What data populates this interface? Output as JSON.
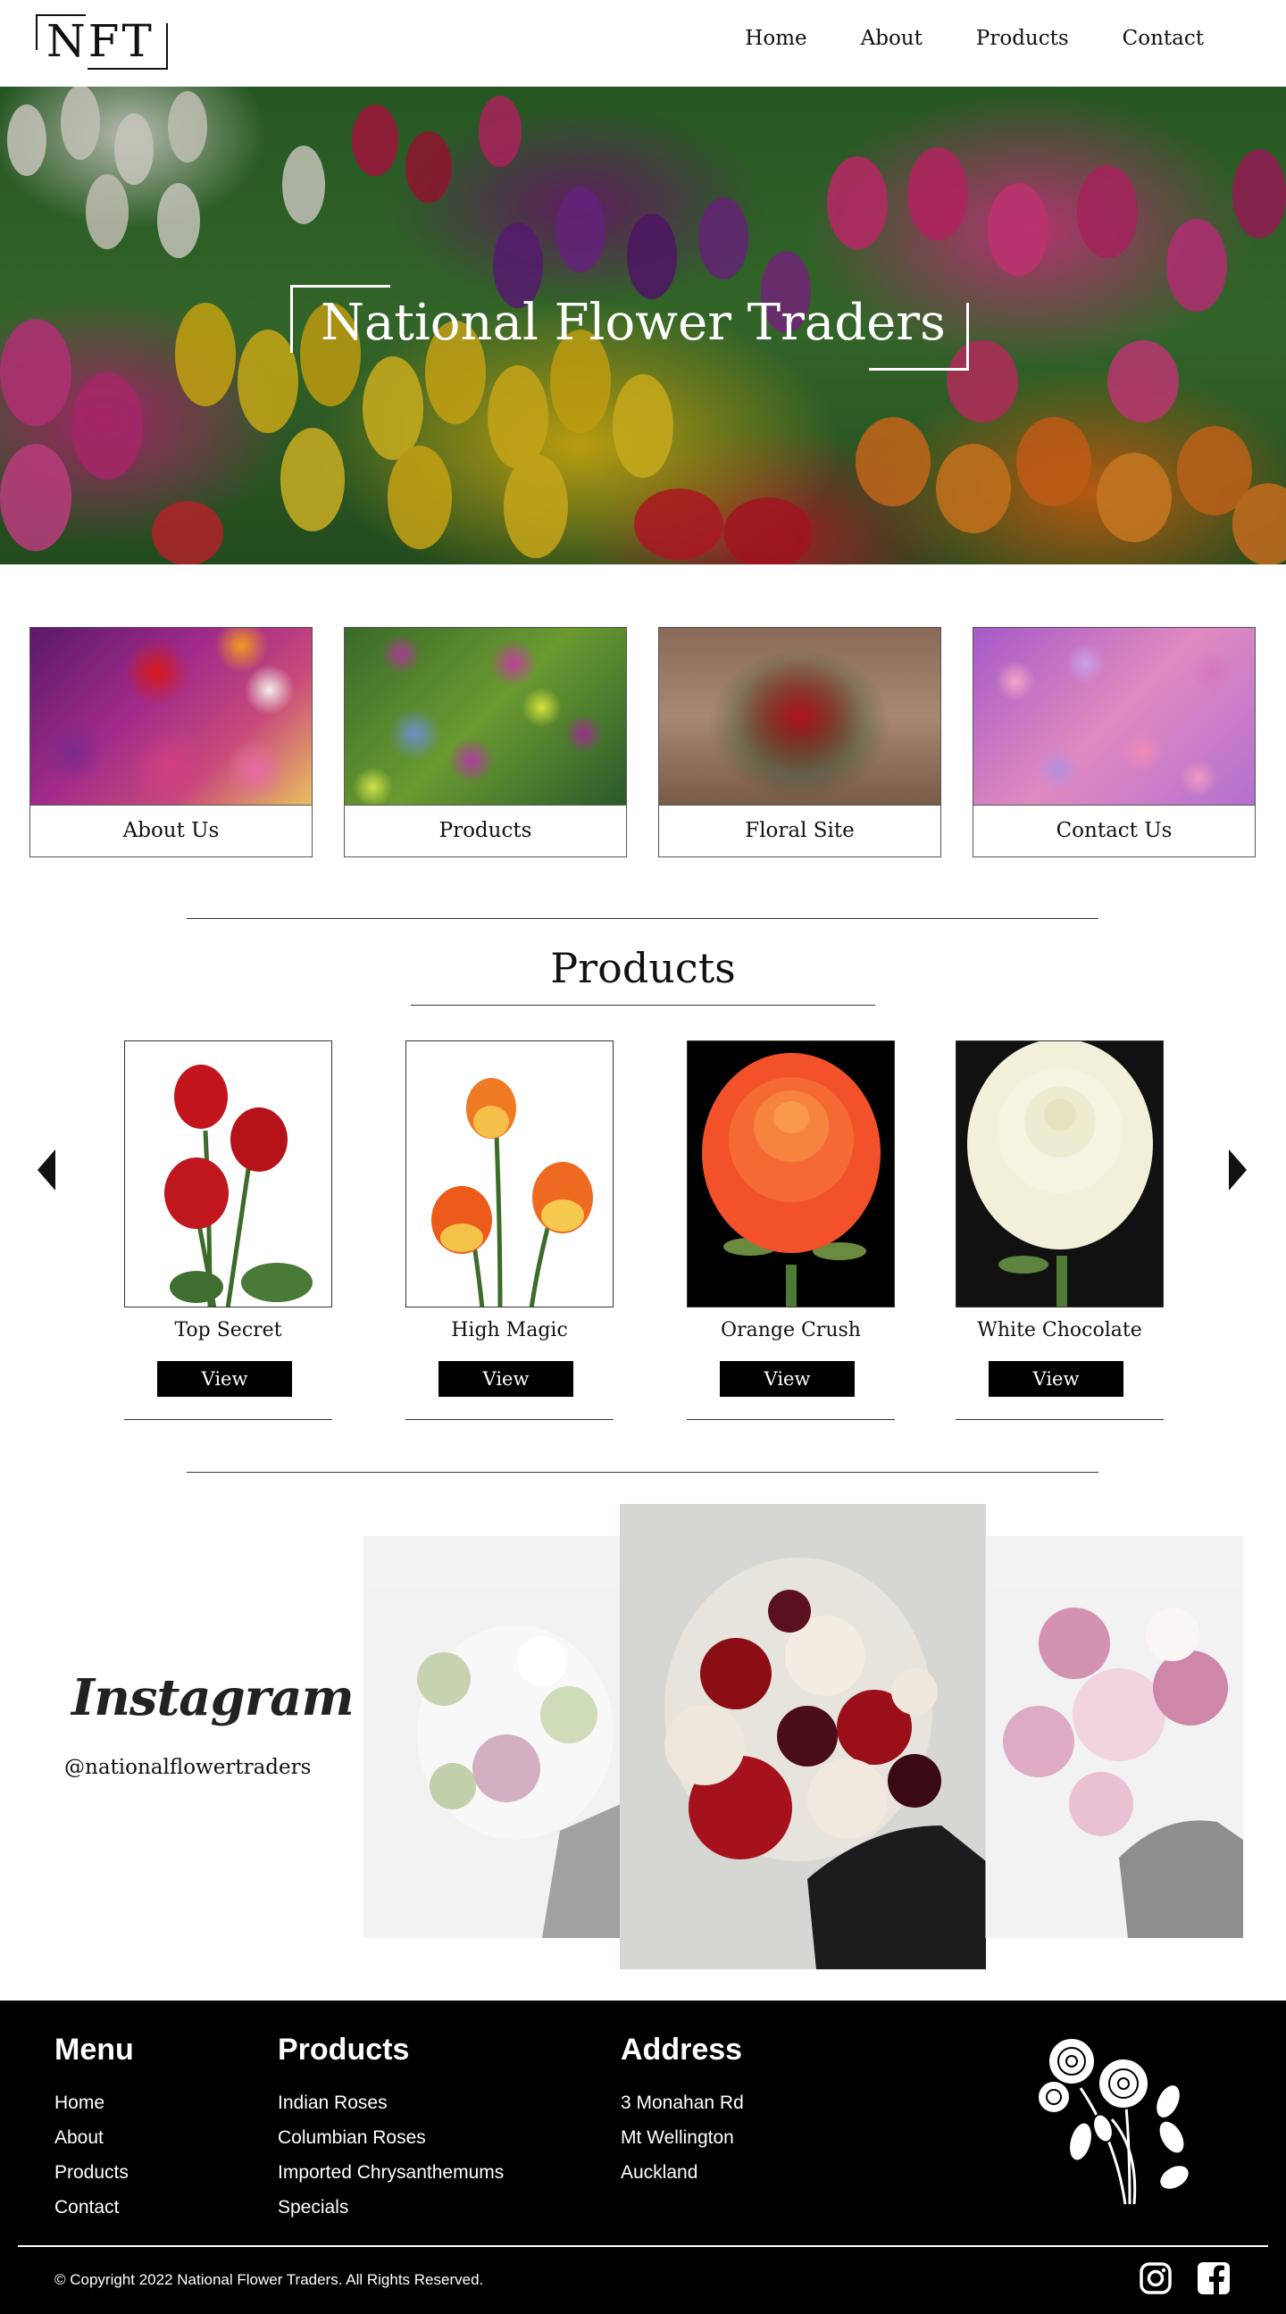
{
  "header": {
    "logo_text": "NFT",
    "nav": [
      "Home",
      "About",
      "Products",
      "Contact"
    ]
  },
  "hero": {
    "title": "National Flower Traders"
  },
  "categories": [
    {
      "label": "About Us"
    },
    {
      "label": "Products"
    },
    {
      "label": "Floral Site"
    },
    {
      "label": "Contact Us"
    }
  ],
  "products_section": {
    "title": "Products",
    "items": [
      {
        "name": "Top Secret",
        "button": "View"
      },
      {
        "name": "High Magic",
        "button": "View"
      },
      {
        "name": "Orange Crush",
        "button": "View"
      },
      {
        "name": "White Chocolate",
        "button": "View"
      }
    ]
  },
  "instagram": {
    "logo": "Instagram",
    "handle": "@nationalflowertraders"
  },
  "footer": {
    "menu": {
      "heading": "Menu",
      "items": [
        "Home",
        "About",
        "Products",
        "Contact"
      ]
    },
    "products": {
      "heading": "Products",
      "items": [
        "Indian Roses",
        "Columbian Roses",
        "Imported Chrysanthemums",
        "Specials"
      ]
    },
    "address": {
      "heading": "Address",
      "lines": [
        "3 Monahan Rd",
        "Mt Wellington",
        "Auckland"
      ]
    },
    "copyright": "© Copyright 2022 National Flower Traders. All Rights Reserved.",
    "social_icons": [
      "instagram-icon",
      "facebook-icon"
    ]
  }
}
